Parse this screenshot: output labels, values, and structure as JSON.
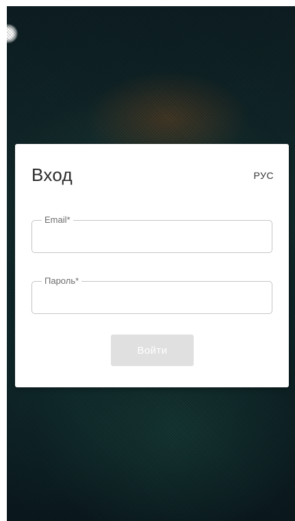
{
  "login": {
    "title": "Вход",
    "language": "РУС",
    "email": {
      "label": "Email*",
      "value": "",
      "placeholder": ""
    },
    "password": {
      "label": "Пароль*",
      "value": "",
      "placeholder": ""
    },
    "submit_label": "Войти"
  },
  "colors": {
    "card_background": "#ffffff",
    "button_disabled": "#e0e0e0",
    "field_border": "#c4c4c4",
    "background_dark": "#0e1f23"
  }
}
